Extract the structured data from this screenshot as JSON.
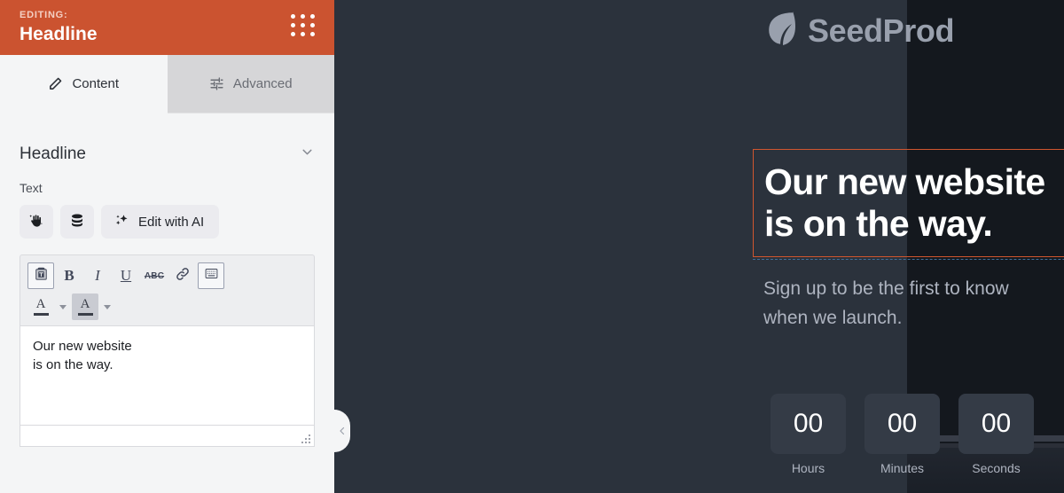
{
  "sidebar": {
    "header": {
      "eyebrow": "EDITING:",
      "title": "Headline",
      "drag_handle_icon": "grid-dots-icon"
    },
    "tabs": [
      {
        "label": "Content",
        "icon": "pencil-icon",
        "active": true
      },
      {
        "label": "Advanced",
        "icon": "sliders-icon",
        "active": false
      }
    ],
    "section": {
      "title": "Headline",
      "collapse_icon": "chevron-down-icon"
    },
    "text_field": {
      "label": "Text",
      "buttons": [
        {
          "name": "magic-hand-icon",
          "label": ""
        },
        {
          "name": "database-icon",
          "label": ""
        },
        {
          "name": "edit-with-ai-button",
          "label": "Edit with AI",
          "icon": "sparkles-icon"
        }
      ]
    },
    "editor": {
      "toolbar_row1": [
        {
          "name": "paste-as-text-button",
          "icon": "clipboard-icon",
          "state": "boxed"
        },
        {
          "name": "bold-button",
          "icon": "bold-icon",
          "label": "B"
        },
        {
          "name": "italic-button",
          "icon": "italic-icon",
          "label": "I"
        },
        {
          "name": "underline-button",
          "icon": "underline-icon",
          "label": "U"
        },
        {
          "name": "strikethrough-button",
          "icon": "strikethrough-icon",
          "label": "ABC"
        },
        {
          "name": "insert-link-button",
          "icon": "link-icon"
        },
        {
          "name": "source-code-button",
          "icon": "keyboard-icon",
          "state": "boxed"
        }
      ],
      "toolbar_row2": [
        {
          "name": "text-color-button",
          "icon": "letter-a-underline-icon",
          "state": "plain"
        },
        {
          "name": "text-color-dropdown",
          "icon": "caret-down-icon"
        },
        {
          "name": "highlight-color-button",
          "icon": "letter-a-underline-icon",
          "state": "shaded"
        },
        {
          "name": "highlight-color-dropdown",
          "icon": "caret-down-icon"
        }
      ],
      "content_line1": "Our new website",
      "content_line2": "is on the way.",
      "resize_grip_icon": "resize-grip-icon"
    }
  },
  "preview": {
    "logo": {
      "text": "SeedProd",
      "icon": "leaf-icon"
    },
    "headline": {
      "line1": "Our new website",
      "line2": "is on the way.",
      "selected": true,
      "selection_color": "#d0562f"
    },
    "subtitle": {
      "line1": "Sign up to be the first to know",
      "line2": "when we launch."
    },
    "countdown": [
      {
        "value": "00",
        "label": "Hours"
      },
      {
        "value": "00",
        "label": "Minutes"
      },
      {
        "value": "00",
        "label": "Seconds"
      }
    ],
    "collapse_handle_icon": "chevron-left-icon"
  },
  "colors": {
    "header_orange": "#cb5330",
    "sidebar_bg": "#f4f5f6",
    "tab_inactive_bg": "#d6d6d8",
    "preview_bg": "#2b323c",
    "preview_dark_bg": "#14181e",
    "countdown_box": "#343b46",
    "muted_text": "#aeb4c0",
    "selection_dash": "#3f6f9c"
  }
}
